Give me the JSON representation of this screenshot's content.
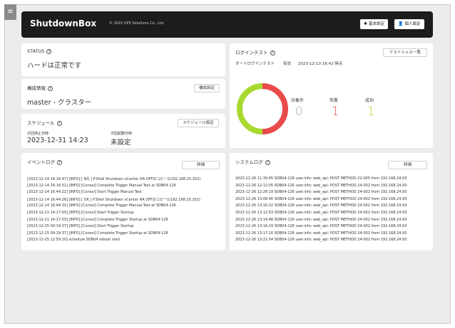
{
  "header": {
    "logo": "ShutdownBox",
    "copyright": "© 2022 UPS Solutions Co., Ltd.",
    "basic_settings": "基本設定",
    "personal_settings": "個人設定"
  },
  "status": {
    "title": "STATUS",
    "text": "ハードは正常です"
  },
  "config": {
    "title": "構成情報",
    "button": "構成設定",
    "value": "master - クラスター"
  },
  "schedule": {
    "title": "スケジュール",
    "button": "スケジュール設定",
    "next_stop_label": "次回停止日時",
    "next_stop_value": "2023-12-31 14:23",
    "next_start_label": "次回起動日時",
    "next_start_value": "未設定"
  },
  "login_test": {
    "title": "ログインテスト",
    "button": "テストシェル一覧",
    "auto_label": "オートログインテスト",
    "auto_state": "有効",
    "auto_time": "2023-12-13 16:42 時点",
    "stats": [
      {
        "label": "対象外",
        "value": "0"
      },
      {
        "label": "失敗",
        "value": "1"
      },
      {
        "label": "成功",
        "value": "1"
      }
    ],
    "colors": {
      "excluded": "#aaaaaa",
      "failed": "#e94b4b",
      "success": "#a8d92f"
    },
    "chart_data": {
      "type": "pie",
      "categories": [
        "対象外",
        "失敗",
        "成功"
      ],
      "values": [
        0,
        1,
        1
      ]
    }
  },
  "event_log": {
    "title": "イベントログ",
    "button": "詳細",
    "lines": [
      "[2023-12-14 16:16:47] [INFO] [ NG ] P.Shell Shutdown vCenter HA OFFのコピー1(192.168.25.202)",
      "[2023-12-14 16:16:51] [INFO] [Consol] Complete Trigger Manual Test at SDB04-126",
      "[2023-12-14 16:44:22] [INFO] [Consol] Start Trigger Manual Test",
      "[2023-12-14 16:44:26] [INFO] [ OK ] P.Shell Shutdown vCenter HA OFFのコピー1(192.168.25.202)",
      "[2023-12-14 16:44:31] [INFO] [Consol] Complete Trigger Manual Test at SDB04-126",
      "[2023-12-21 14:17:03] [INFO] [Consol] Start Trigger Startup",
      "[2023-12-21 14:17:03] [INFO] [Consol] Complete Trigger Startup at SDB04-126",
      "[2023-12-25 09:19:37] [INFO] [Consol] Start Trigger Startup",
      "[2023-12-25 09:19:37] [INFO] [Consol] Complete Trigger Startup at SDB04-126",
      "[2023-12-25 12:59:10] schedule SDB04 reboot start"
    ]
  },
  "system_log": {
    "title": "システムログ",
    "button": "詳細",
    "lines": [
      "2023-12-26 11:30:45 SDB04-126 user.info: web_api: POST METHOD 22-005 from 192.168.24.93",
      "2023-12-26 12:12:05 SDB04-126 user.info: web_api: POST METHOD 24-002 from 192.168.24.93",
      "2023-12-26 12:26:19 SDB04-126 user.info: web_api: POST METHOD 24-002 from 192.168.24.93",
      "2023-12-26 13:08:46 SDB04-126 user.info: web_api: POST METHOD 24-002 from 192.168.24.93",
      "2023-12-26 13:10:22 SDB04-126 user.info: web_api: POST METHOD 24-002 from 192.168.24.93",
      "2023-12-26 13:12:53 SDB04-126 user.info: web_api: POST METHOD 24-002 from 192.168.24.93",
      "2023-12-26 13:14:48 SDB04-126 user.info: web_api: POST METHOD 24-002 from 192.168.24.93",
      "2023-12-26 13:16:19 SDB04-126 user.info: web_api: POST METHOD 24-002 from 192.168.24.93",
      "2023-12-26 13:17:10 SDB04-126 user.info: web_api: POST METHOD 24-002 from 192.168.24.93",
      "2023-12-26 13:21:54 SDB04-126 user.info: web_api: POST METHOD 24-002 from 192.168.24.93"
    ]
  }
}
